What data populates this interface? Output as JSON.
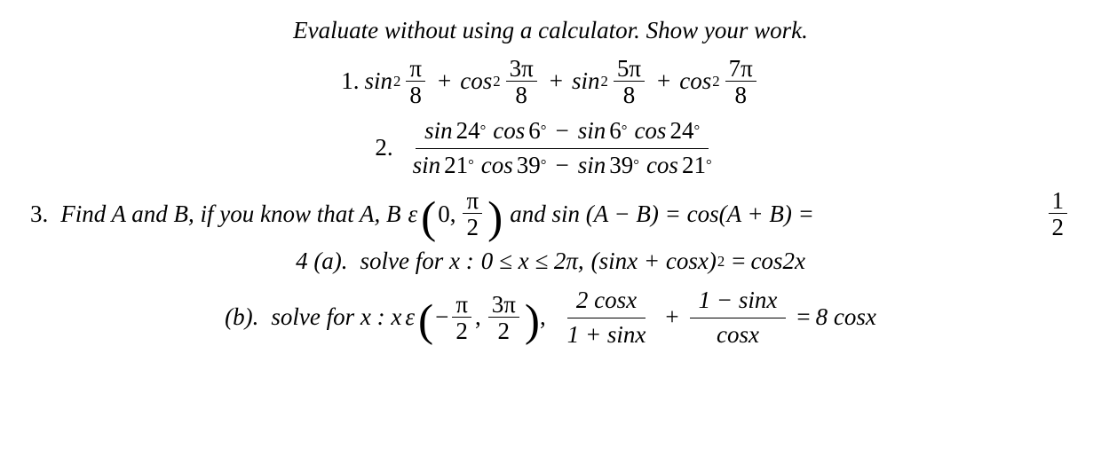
{
  "instruction": "Evaluate without using a calculator.  Show your work.",
  "q1": {
    "label": "1.",
    "fn": "sin",
    "fn2": "cos",
    "exp": "2",
    "plus": "+",
    "t1n": "π",
    "t1d": "8",
    "t2n": "3π",
    "t2d": "8",
    "t3n": "5π",
    "t3d": "8",
    "t4n": "7π",
    "t4d": "8"
  },
  "q2": {
    "label": "2.",
    "sin": "sin",
    "cos": "cos",
    "deg": "°",
    "minus": "−",
    "a": "24",
    "b": "6",
    "c": "21",
    "d": "39"
  },
  "q3": {
    "label": "3.",
    "lead": "Find A and B,  if you know that A,  B",
    "eps": "ε",
    "zero": "0",
    "comma": ",",
    "pi": "π",
    "two": "2",
    "mid": "and sin (A − B) = cos(A + B) =",
    "rhs_n": "1",
    "rhs_d": "2"
  },
  "q4a": {
    "label": "4 (a).",
    "lead": "solve for x :",
    "range": "0 ≤ x ≤ 2π,",
    "lhs1": "(sinx + cosx)",
    "exp": "2",
    "eq": "=",
    "rhs": "cos2x"
  },
  "q4b": {
    "label": "(b).",
    "lead": "solve for x : x",
    "eps": "ε",
    "lo_n": "π",
    "lo_d": "2",
    "hi_n": "3π",
    "hi_d": "2",
    "neg": "−",
    "comma": ",",
    "after_interval": ",",
    "f1n": "2 cosx",
    "f1d": "1 + sinx",
    "plus": "+",
    "f2n": "1 − sinx",
    "f2d": "cosx",
    "eq": "=",
    "rhs": "8 cosx"
  }
}
